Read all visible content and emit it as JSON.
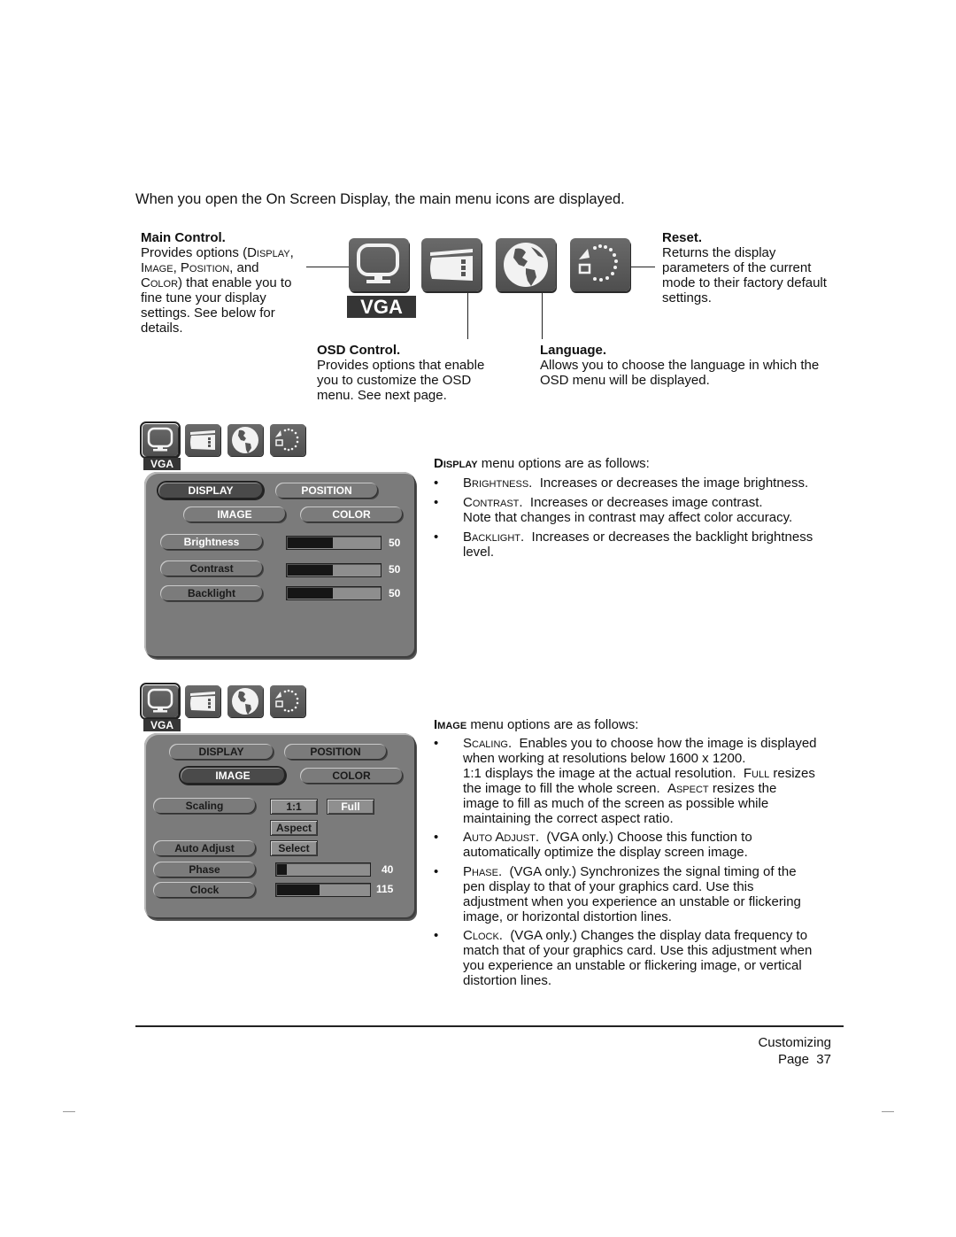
{
  "intro": "When you open the On Screen Display, the main menu icons are displayed.",
  "callouts": {
    "main_control": {
      "title": "Main Control.",
      "lines": [
        "Provides options (Display,",
        "Image, Position, and",
        "Color) that enable you to",
        "fine tune your display",
        "settings.  See below for",
        "details."
      ]
    },
    "reset": {
      "title": "Reset.",
      "lines": [
        "Returns the display",
        "parameters of the current",
        "mode to their factory default",
        "settings."
      ]
    },
    "osd_control": {
      "title": "OSD Control.",
      "lines": [
        "Provides options that enable",
        "you to customize the OSD",
        "menu.  See next page."
      ]
    },
    "language": {
      "title": "Language.",
      "lines": [
        "Allows you to choose the language in which the",
        "OSD menu will be displayed."
      ]
    }
  },
  "icons": {
    "main_control": "monitor-icon",
    "osd_control": "osd-window-icon",
    "language": "globe-icon",
    "reset": "reset-icon",
    "input_label": "VGA"
  },
  "display_osd": {
    "tabs": [
      "DISPLAY",
      "POSITION",
      "IMAGE",
      "COLOR"
    ],
    "selected_tab": "DISPLAY",
    "rows": [
      {
        "label": "Brightness",
        "value": "50",
        "fraction": 0.5
      },
      {
        "label": "Contrast",
        "value": "50",
        "fraction": 0.5
      },
      {
        "label": "Backlight",
        "value": "50",
        "fraction": 0.5
      }
    ]
  },
  "display_text": {
    "heading_sc": "Display",
    "heading_rest": " menu options are as follows:",
    "items": [
      {
        "term": "Brightness.",
        "lines": [
          "Increases or decreases the image brightness."
        ]
      },
      {
        "term": "Contrast.",
        "lines": [
          "Increases or decreases image contrast.",
          "Note that changes in contrast may affect color accuracy."
        ]
      },
      {
        "term": "Backlight.",
        "lines": [
          "Increases or decreases the backlight brightness",
          "level."
        ]
      }
    ]
  },
  "image_osd": {
    "tabs": [
      "DISPLAY",
      "POSITION",
      "IMAGE",
      "COLOR"
    ],
    "selected_tab": "IMAGE",
    "scaling_label": "Scaling",
    "scaling_options": [
      "1:1",
      "Full",
      "Aspect"
    ],
    "scaling_selected": "Full",
    "auto_adjust_label": "Auto Adjust",
    "auto_adjust_button": "Select",
    "rows": [
      {
        "label": "Phase",
        "value": "40",
        "fraction": 0.12
      },
      {
        "label": "Clock",
        "value": "115",
        "fraction": 0.47
      }
    ]
  },
  "image_text": {
    "heading_sc": "Image",
    "heading_rest": " menu options are as follows:",
    "scaling_term": "Scaling.",
    "scaling_lines": [
      "Enables you to choose how the image is displayed",
      "when working at resolutions below 1600 x 1200.",
      "1:1 displays the image at the actual resolution.  Full resizes",
      "the image to fill the whole screen.  Aspect resizes the",
      "image to fill as much of the screen as possible while",
      "maintaining the correct aspect ratio."
    ],
    "auto_term": "Auto Adjust.",
    "auto_lines": [
      "(VGA only.)  Choose this function to",
      "automatically optimize the display screen image."
    ],
    "phase_term": "Phase.",
    "phase_lines": [
      "(VGA only.)  Synchronizes the signal timing of the",
      "pen display to that of your graphics card.  Use this",
      "adjustment when you experience an unstable or flickering",
      "image, or horizontal distortion lines."
    ],
    "clock_term": "Clock.",
    "clock_lines": [
      "(VGA only.)  Changes the display data frequency to",
      "match that of your graphics card.  Use this adjustment when",
      "you experience an unstable or flickering image, or vertical",
      "distortion lines."
    ]
  },
  "footer": {
    "section": "Customizing",
    "page": "Page  37"
  }
}
